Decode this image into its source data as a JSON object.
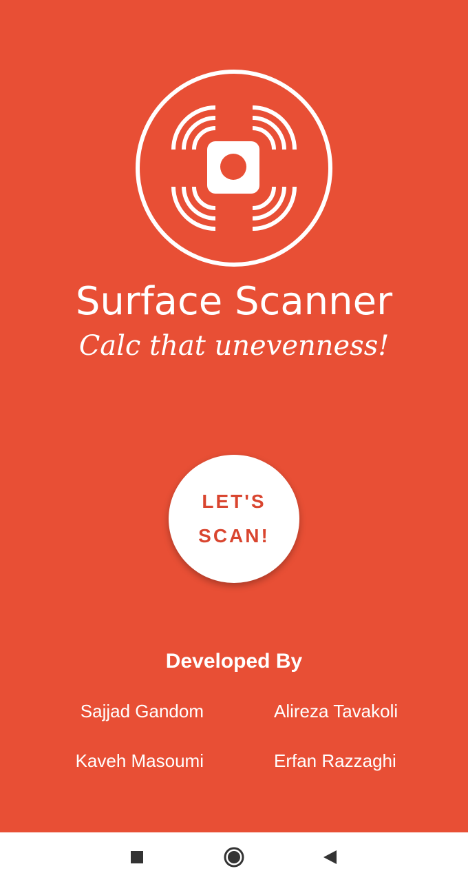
{
  "app": {
    "title": "Surface Scanner",
    "tagline": "Calc that unevenness!",
    "logo_icon": "surface-scanner-logo-icon"
  },
  "scan_button": {
    "label": "LET'S SCAN!"
  },
  "developers": {
    "heading": "Developed By",
    "names": [
      "Sajjad Gandom",
      "Alireza Tavakoli",
      "Kaveh Masoumi",
      "Erfan Razzaghi"
    ]
  },
  "nav_bar": {
    "recents_icon": "square-icon",
    "home_icon": "circle-icon",
    "back_icon": "triangle-back-icon"
  },
  "colors": {
    "background": "#E84F35",
    "button_text": "#D9452F",
    "foreground": "#FFFFFF",
    "nav_bar_bg": "#FFFFFF",
    "nav_icon": "#333333"
  }
}
